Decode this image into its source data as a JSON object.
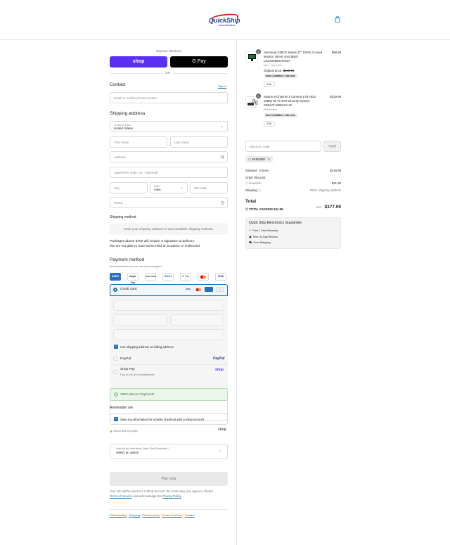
{
  "header": {
    "brand": "QuickShip",
    "brand_sub": "ELECTRONICS",
    "cart_icon": "shopping-bag-icon"
  },
  "express": {
    "label": "Express checkout",
    "shop_label": "shop",
    "gpay_label": "G Pay",
    "or": "OR"
  },
  "contact": {
    "title": "Contact",
    "signin": "Sign in",
    "placeholder": "Email or mobile phone number"
  },
  "shipping": {
    "title": "Shipping address",
    "country_label": "Country/Region",
    "country_value": "United States",
    "first_name": "First name",
    "last_name": "Last name",
    "address": "Address",
    "apartment": "Apartment, suite, etc. (optional)",
    "city": "City",
    "state_label": "State",
    "state_value": "Iowa",
    "zip": "ZIP code",
    "phone": "Phone"
  },
  "shipping_method": {
    "title": "Shipping method",
    "placeholder": "Enter your shipping address to view available shipping methods."
  },
  "notice": {
    "line1": "Packages above $700 will require a signature at delivery.",
    "line2": "We are not able to have items held at locations or redirected."
  },
  "payment": {
    "title": "Payment method",
    "subtitle": "All transactions are secure and encrypted.",
    "icons": [
      "AMEX",
      "Apple Pay",
      "DISCOVER",
      "Diners",
      "G Pay",
      "Mastercard",
      "VISA"
    ],
    "credit_card": "Credit card",
    "billing_same": "Use shipping address as billing address",
    "paypal": "PayPal",
    "paypal_logo": "PayPal",
    "shoppay": "Shop Pay",
    "shoppay_sub": "Pay in full or in installments",
    "shoppay_logo": "shop",
    "secure": "100% Secure Payments"
  },
  "remember": {
    "title": "Remember me",
    "save_label": "Save my information for a faster checkout with a Shop account",
    "secure_note": "Secure and encrypted",
    "shop_logo": "shop"
  },
  "survey": {
    "label": "How did you hear about Quick Ship Electronics?",
    "value": "Select an option"
  },
  "pay_now": "Pay now",
  "legal": {
    "text1": "Your info will be saved to a Shop account. By continuing, you agree to Shop's",
    "terms": "Terms of Service",
    "text2": "and acknowledge the",
    "privacy": "Privacy Policy",
    "end": "."
  },
  "footer_links": [
    "Refund policy",
    "Shipping",
    "Privacy policy",
    "Terms of service",
    "Contact"
  ],
  "cart": {
    "items": [
      {
        "qty": "1",
        "title_lines": [
          "Samsung S36CG Series 27\" 100Hz Curved",
          "Monitor 180Hz 4ms Black",
          "LS27D360GANXZA"
        ],
        "condition": "New · Open Box",
        "orig_label": "Original price:",
        "orig_price": "$249.99",
        "pill": "Item Condition: Like-new",
        "edit": "Edit",
        "price": "$99.99"
      },
      {
        "qty": "1",
        "title_lines": [
          "Swann 8-Channel 2 Camera 1TB HDD",
          "1080p Wi-Fi NVR Security System",
          "SWNVK-500KH2-US"
        ],
        "condition": "Refurbished",
        "pill": "Item Condition: Like-new",
        "edit": "Edit",
        "price": "$319.99"
      }
    ],
    "discount_placeholder": "Discount code",
    "apply": "Apply",
    "applied_code": "SKIBORD",
    "subtotal_label": "Subtotal · 2 items",
    "subtotal_value": "$419.98",
    "order_discount_label": "Order discount",
    "order_discount_code": "SKIBORD",
    "order_discount_value": "- $41.99",
    "shipping_label": "Shipping",
    "shipping_value": "Enter shipping address",
    "total_label": "Total",
    "currency": "USD",
    "total_value": "$377.99",
    "savings_label": "TOTAL SAVINGS",
    "savings_value": "$41.99"
  },
  "guarantee": {
    "title": "Quick Ship Electronics Guarantee",
    "items": [
      "Free 1 Year Warranty",
      "Free 30 Day Returns",
      "Free Shipping"
    ]
  }
}
